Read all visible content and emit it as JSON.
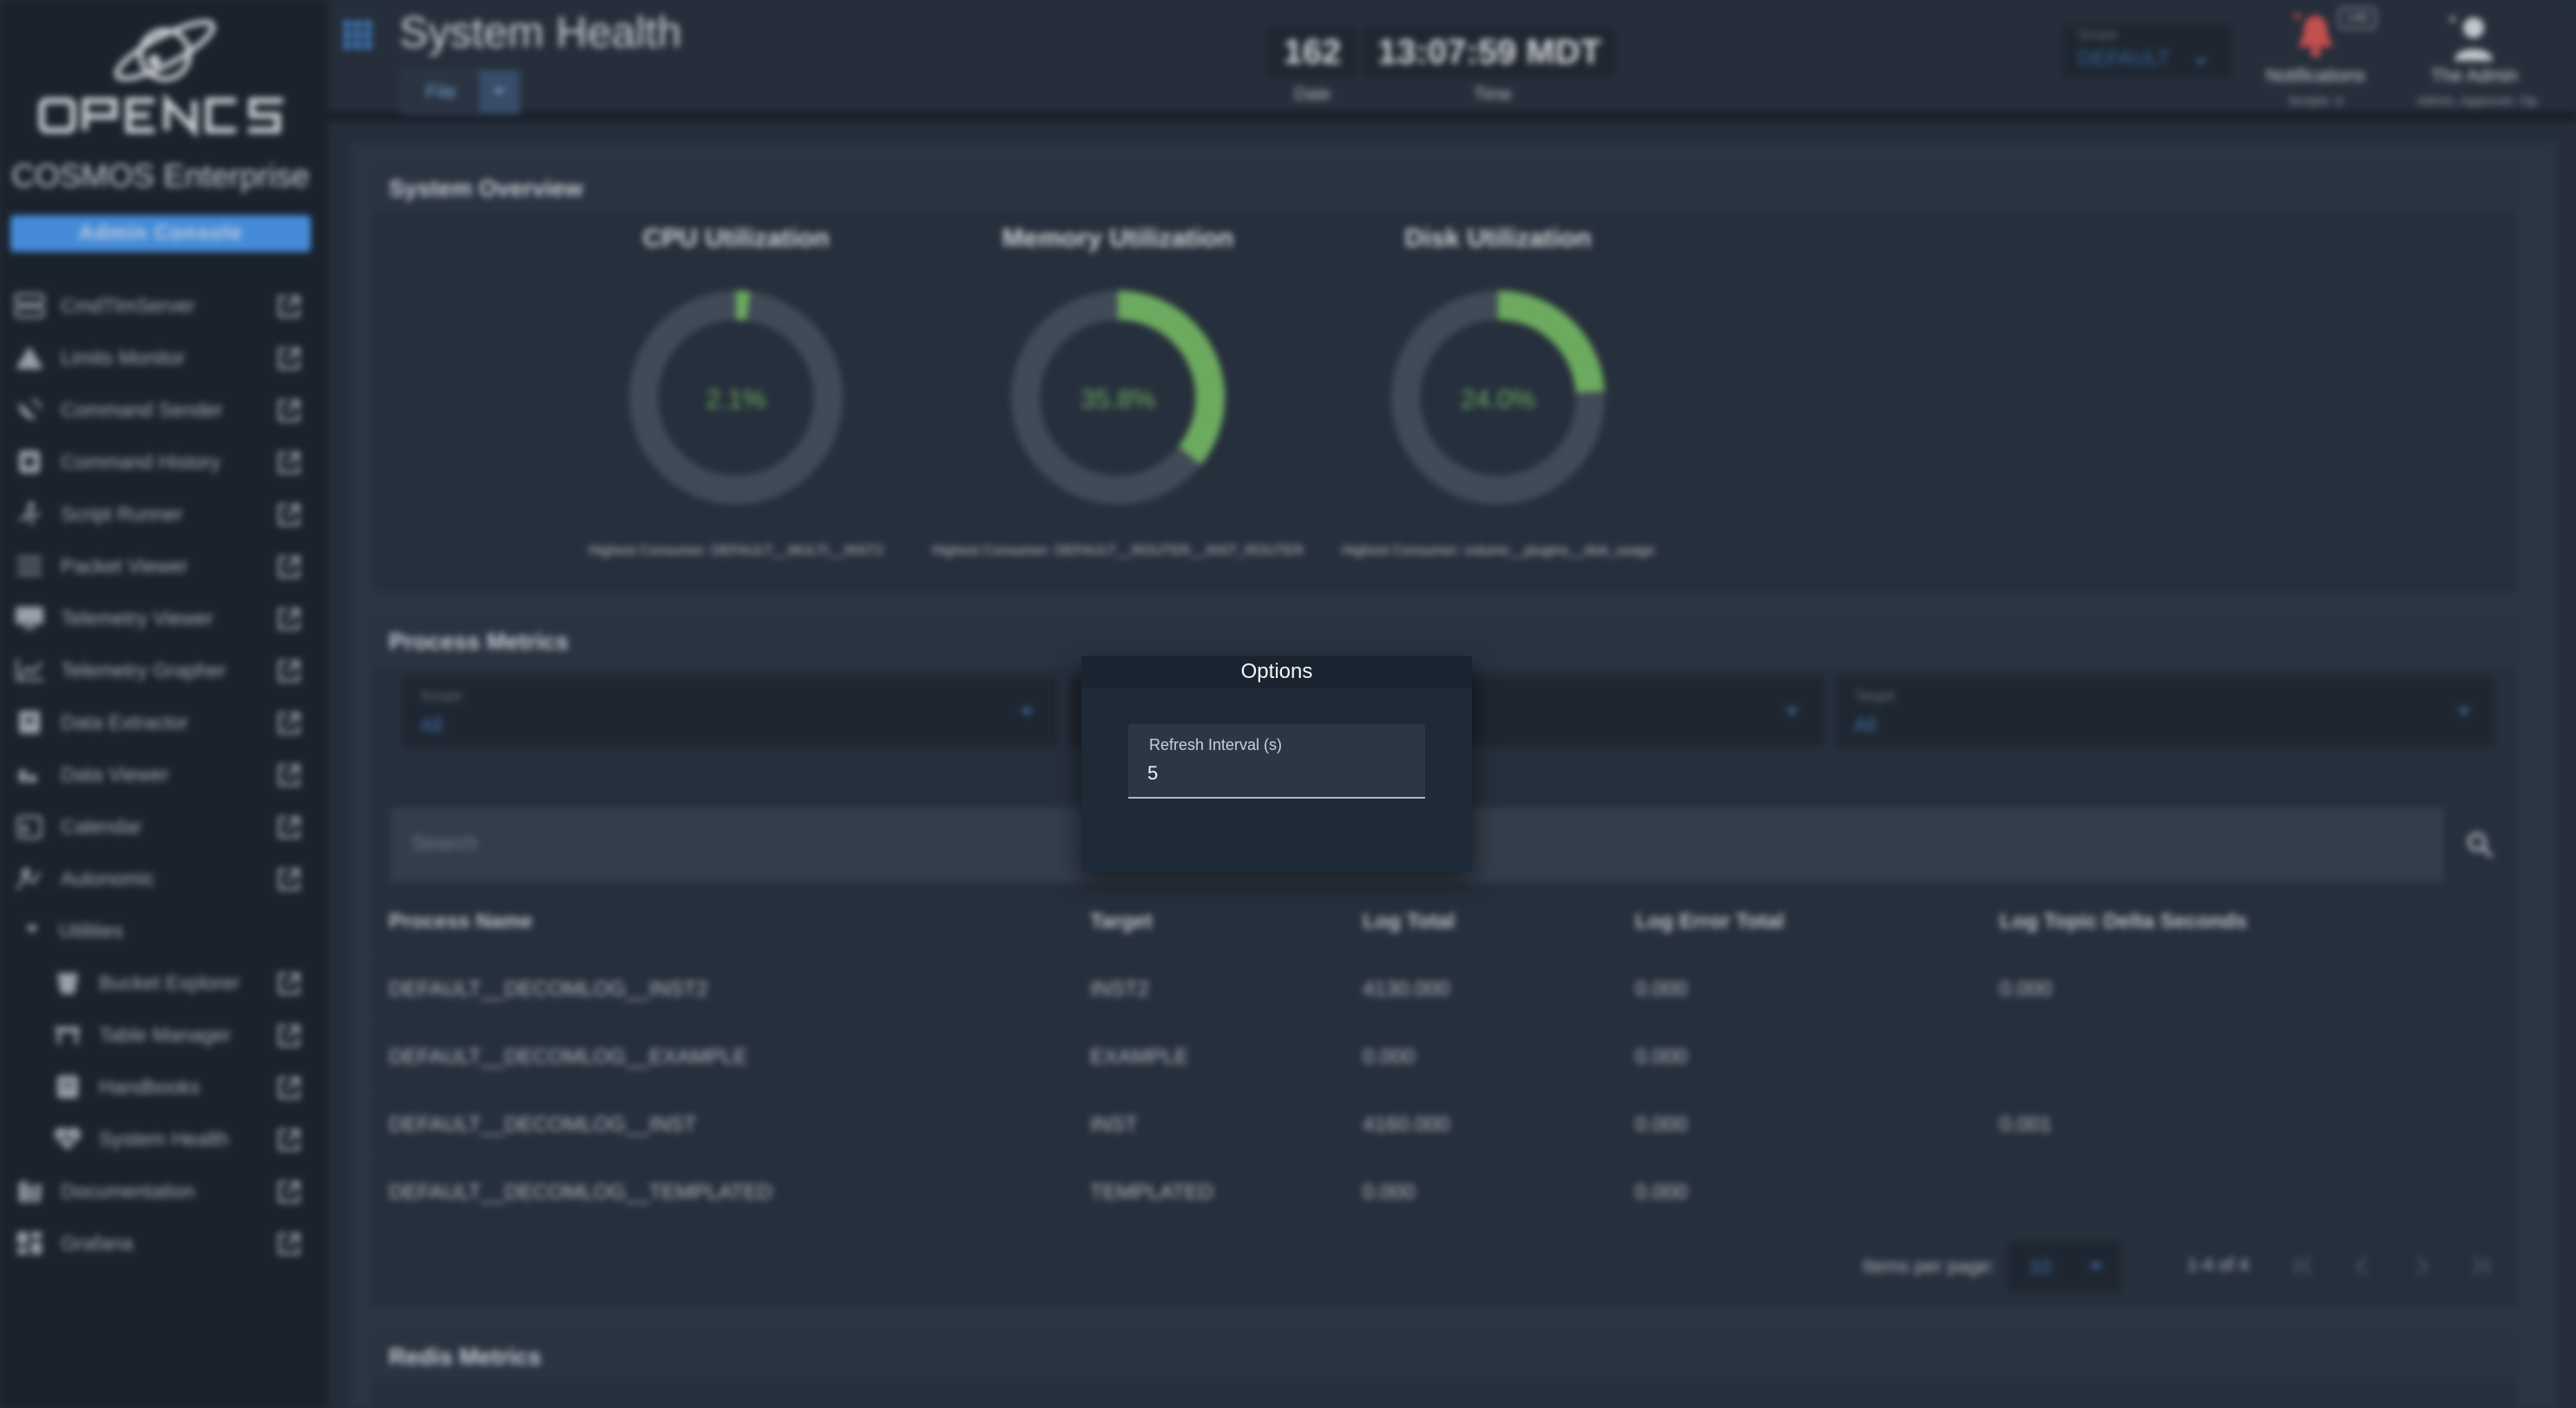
{
  "sidebar": {
    "brand": "COSMOS Enterprise",
    "admin_button": "Admin Console",
    "items": [
      {
        "label": "CmdTlmServer"
      },
      {
        "label": "Limits Monitor"
      },
      {
        "label": "Command Sender"
      },
      {
        "label": "Command History"
      },
      {
        "label": "Script Runner"
      },
      {
        "label": "Packet Viewer"
      },
      {
        "label": "Telemetry Viewer"
      },
      {
        "label": "Telemetry Grapher"
      },
      {
        "label": "Data Extractor"
      },
      {
        "label": "Data Viewer"
      },
      {
        "label": "Calendar"
      },
      {
        "label": "Autonomic"
      }
    ],
    "utilities": {
      "label": "Utilities",
      "items": [
        {
          "label": "Bucket Explorer"
        },
        {
          "label": "Table Manager"
        },
        {
          "label": "Handbooks"
        },
        {
          "label": "System Health"
        }
      ]
    },
    "bottom_items": [
      {
        "label": "Documentation"
      },
      {
        "label": "Grafana"
      }
    ]
  },
  "header": {
    "title": "System Health",
    "file_menu": "File",
    "counter": "162",
    "counter_caption": "Date",
    "clock": "13:07:59 MDT",
    "clock_caption": "Time",
    "scope_label": "Scope",
    "scope_value": "DEFAULT",
    "notif_badge": "140",
    "notif_label": "Notifications",
    "notif_sub": "Scripts: 0",
    "user_label": "The Admin",
    "user_sub": "Admin, Approver, Op"
  },
  "overview": {
    "title": "System Overview",
    "gauges": [
      {
        "title": "CPU Utilization",
        "value_text": "2.1%",
        "value": 2.1,
        "consumer": "Highest Consumer: DEFAULT__MULTI__INST2"
      },
      {
        "title": "Memory Utilization",
        "value_text": "35.8%",
        "value": 35.8,
        "consumer": "Highest Consumer: DEFAULT__ROUTER__INST_ROUTER"
      },
      {
        "title": "Disk Utilization",
        "value_text": "24.0%",
        "value": 24.0,
        "consumer": "Highest Consumer: volume__plugins__disk_usage"
      }
    ]
  },
  "process_metrics": {
    "title": "Process Metrics",
    "filters": [
      {
        "label": "Scope",
        "value": "All"
      },
      {
        "label": "Target",
        "value": "All"
      }
    ],
    "search_placeholder": "Search",
    "columns": [
      "Process Name",
      "Target",
      "Log Total",
      "Log Error Total",
      "Log Topic Delta Seconds"
    ],
    "rows": [
      [
        "DEFAULT__DECOMLOG__INST2",
        "INST2",
        "4130.000",
        "0.000",
        "0.000"
      ],
      [
        "DEFAULT__DECOMLOG__EXAMPLE",
        "EXAMPLE",
        "0.000",
        "0.000",
        ""
      ],
      [
        "DEFAULT__DECOMLOG__INST",
        "INST",
        "4160.000",
        "0.000",
        "0.001"
      ],
      [
        "DEFAULT__DECOMLOG__TEMPLATED",
        "TEMPLATED",
        "0.000",
        "0.000",
        ""
      ]
    ],
    "items_per_page_label": "Items per page:",
    "items_per_page": "10",
    "range": "1-4 of 4"
  },
  "redis": {
    "title": "Redis Metrics"
  },
  "dialog": {
    "title": "Options",
    "field_label": "Refresh Interval (s)",
    "field_value": "5"
  },
  "colors": {
    "gauge_fill": "#7cc36d",
    "gauge_track": "#4a5563",
    "accent": "#4f9ff7"
  }
}
